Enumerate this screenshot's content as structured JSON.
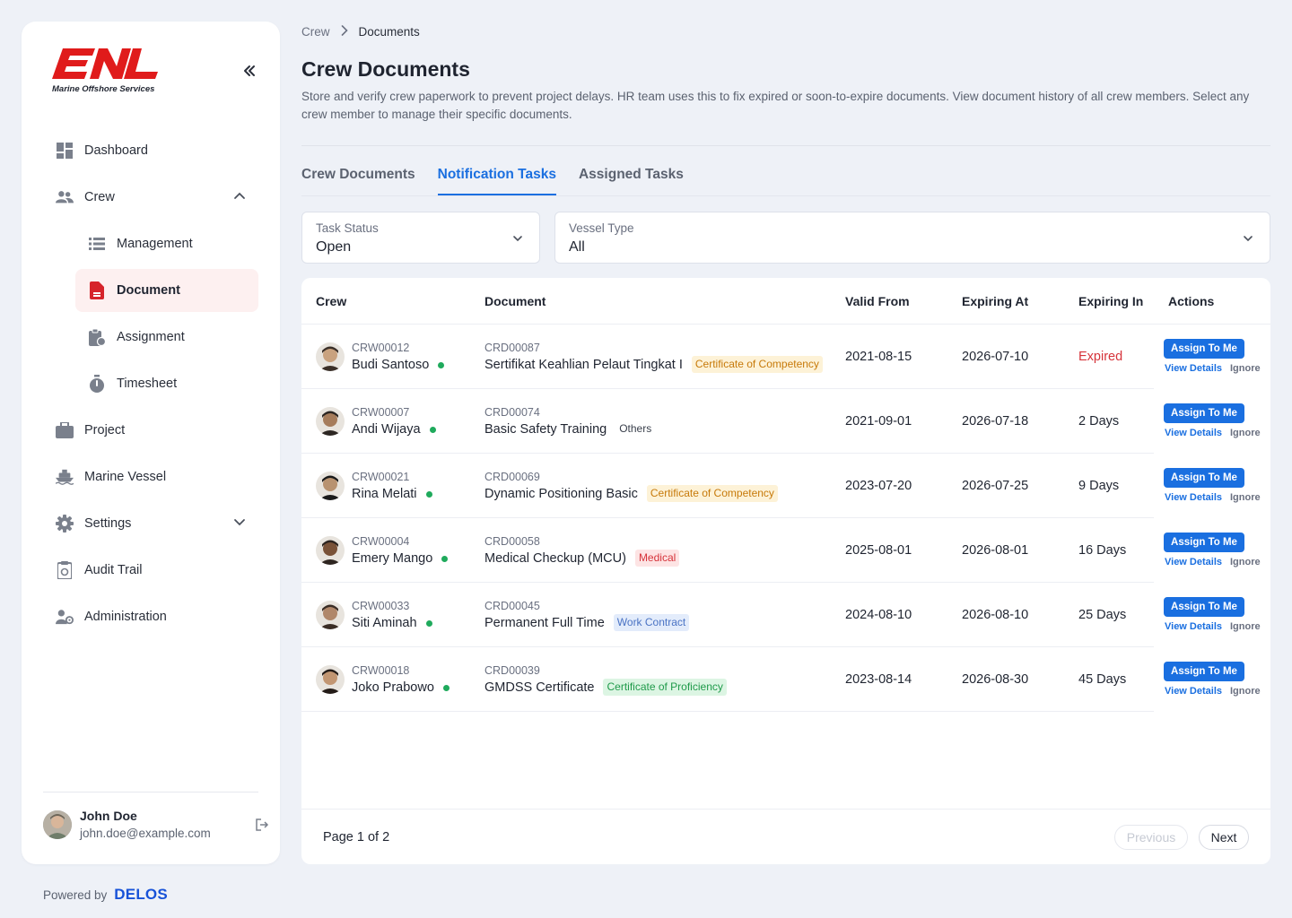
{
  "brand": {
    "logo_text": "ENL",
    "logo_subtitle": "Marine Offshore Services",
    "logo_color": "#e01b1b"
  },
  "sidebar": {
    "items": [
      {
        "label": "Dashboard",
        "icon": "dashboard-icon"
      },
      {
        "label": "Crew",
        "icon": "users-icon",
        "expanded": true
      },
      {
        "label": "Management",
        "icon": "list-icon"
      },
      {
        "label": "Document",
        "icon": "document-icon",
        "active": true
      },
      {
        "label": "Assignment",
        "icon": "clipboard-icon"
      },
      {
        "label": "Timesheet",
        "icon": "stopwatch-icon"
      },
      {
        "label": "Project",
        "icon": "briefcase-icon"
      },
      {
        "label": "Marine Vessel",
        "icon": "ship-icon"
      },
      {
        "label": "Settings",
        "icon": "gear-icon",
        "expanded": false
      },
      {
        "label": "Audit Trail",
        "icon": "audit-icon"
      },
      {
        "label": "Administration",
        "icon": "user-cog-icon"
      }
    ],
    "user": {
      "name": "John Doe",
      "email": "john.doe@example.com"
    }
  },
  "footer": {
    "powered_by": "Powered by",
    "brand": "DELOS"
  },
  "breadcrumb": {
    "parent": "Crew",
    "current": "Documents"
  },
  "page": {
    "title": "Crew Documents",
    "description": "Store and verify crew paperwork to prevent project delays. HR team uses this to fix expired or soon-to-expire documents. View document history of all crew members. Select any crew member to manage their specific documents."
  },
  "tabs": [
    {
      "label": "Crew Documents",
      "active": false
    },
    {
      "label": "Notification Tasks",
      "active": true
    },
    {
      "label": "Assigned Tasks",
      "active": false
    }
  ],
  "filters": {
    "task_status": {
      "label": "Task Status",
      "value": "Open"
    },
    "vessel_type": {
      "label": "Vessel Type",
      "value": "All"
    }
  },
  "table": {
    "headers": [
      "Crew",
      "Document",
      "Valid From",
      "Expiring At",
      "Expiring In",
      "Actions"
    ],
    "actions": {
      "assign": "Assign To Me",
      "view": "View Details",
      "ignore": "Ignore"
    },
    "rows": [
      {
        "crew_id": "CRW00012",
        "crew_name": "Budi Santoso",
        "doc_id": "CRD00087",
        "doc_name": "Sertifikat Keahlian Pelaut Tingkat I",
        "category": "Certificate of Competency",
        "category_type": "coc",
        "valid_from": "2021-08-15",
        "expiring_at": "2026-07-10",
        "expiring_in": "Expired",
        "expired": true
      },
      {
        "crew_id": "CRW00007",
        "crew_name": "Andi Wijaya",
        "doc_id": "CRD00074",
        "doc_name": "Basic Safety Training",
        "category": "Others",
        "category_type": "others",
        "valid_from": "2021-09-01",
        "expiring_at": "2026-07-18",
        "expiring_in": "2 Days",
        "expired": false
      },
      {
        "crew_id": "CRW00021",
        "crew_name": "Rina Melati",
        "doc_id": "CRD00069",
        "doc_name": "Dynamic Positioning Basic",
        "category": "Certificate of Competency",
        "category_type": "coc",
        "valid_from": "2023-07-20",
        "expiring_at": "2026-07-25",
        "expiring_in": "9 Days",
        "expired": false
      },
      {
        "crew_id": "CRW00004",
        "crew_name": "Emery Mango",
        "doc_id": "CRD00058",
        "doc_name": "Medical Checkup (MCU)",
        "category": "Medical",
        "category_type": "medical",
        "valid_from": "2025-08-01",
        "expiring_at": "2026-08-01",
        "expiring_in": "16 Days",
        "expired": false
      },
      {
        "crew_id": "CRW00033",
        "crew_name": "Siti Aminah",
        "doc_id": "CRD00045",
        "doc_name": "Permanent Full Time",
        "category": "Work Contract",
        "category_type": "work",
        "valid_from": "2024-08-10",
        "expiring_at": "2026-08-10",
        "expiring_in": "25 Days",
        "expired": false
      },
      {
        "crew_id": "CRW00018",
        "crew_name": "Joko Prabowo",
        "doc_id": "CRD00039",
        "doc_name": "GMDSS Certificate",
        "category": "Certificate of Proficiency",
        "category_type": "cop",
        "valid_from": "2023-08-14",
        "expiring_at": "2026-08-30",
        "expiring_in": "45 Days",
        "expired": false
      }
    ]
  },
  "pagination": {
    "info": "Page 1 of 2",
    "previous": "Previous",
    "next": "Next"
  },
  "colors": {
    "accent": "#1a6fe0",
    "danger": "#d6333a",
    "online": "#1faa5c",
    "active_bg": "#fdf0f0"
  }
}
